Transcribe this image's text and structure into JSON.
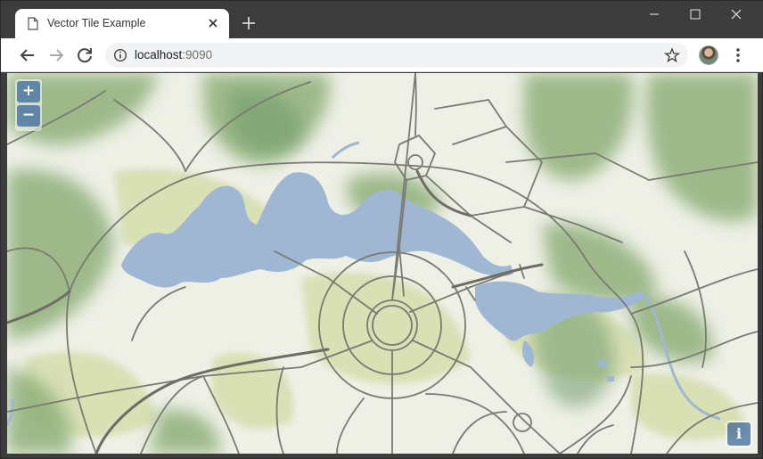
{
  "window": {
    "tab_title": "Vector Tile Example",
    "icons": {
      "tab": "page-icon",
      "close": "close-icon",
      "new_tab": "plus-icon"
    }
  },
  "toolbar": {
    "url_host": "localhost",
    "url_port": ":9090",
    "icons": [
      "back-arrow-icon",
      "forward-arrow-icon",
      "reload-icon",
      "info-icon",
      "star-icon",
      "kebab-menu-icon"
    ]
  },
  "map": {
    "zoom_in_label": "+",
    "zoom_out_label": "−",
    "attribution_label": "i",
    "colors": {
      "land": "#eef0e6",
      "vegetation": "#8fb07a",
      "park": "#d6dfb0",
      "water": "#9fb7d3",
      "road": "#7a7a72",
      "control": "#4f6f9f"
    }
  }
}
